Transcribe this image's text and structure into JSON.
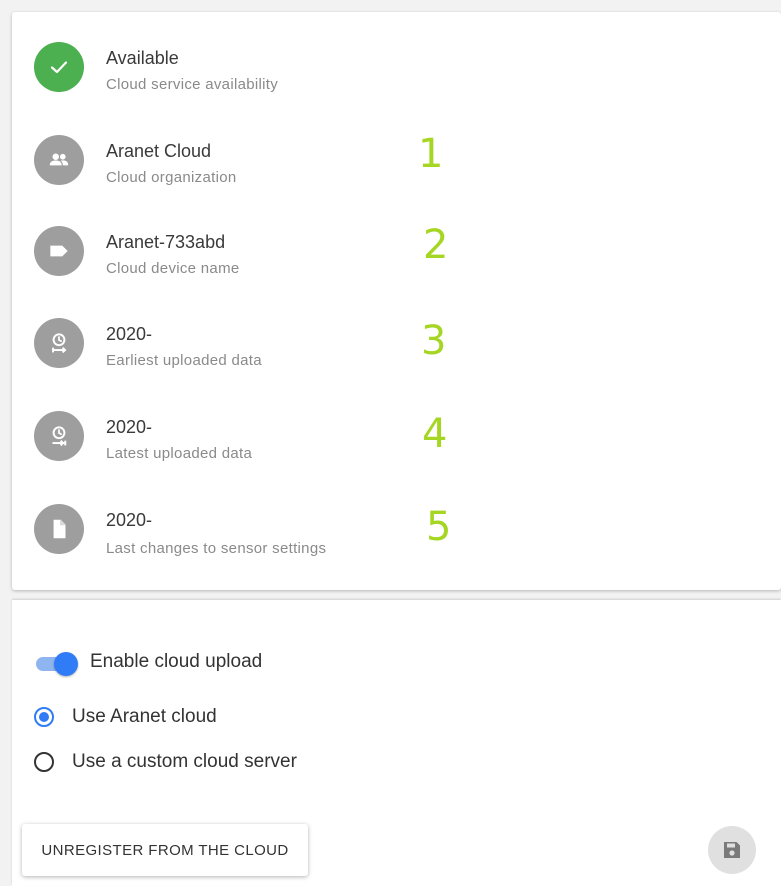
{
  "info_rows": [
    {
      "title": "Available",
      "subtitle": "Cloud service availability",
      "icon": "check-icon",
      "marker": ""
    },
    {
      "title": "Aranet Cloud",
      "subtitle": "Cloud organization",
      "icon": "people-icon",
      "marker": "1"
    },
    {
      "title": "Aranet-733abd",
      "subtitle": "Cloud device name",
      "icon": "label-icon",
      "marker": "2"
    },
    {
      "title": "2020-",
      "subtitle": "Earliest uploaded data",
      "icon": "clock-start-icon",
      "marker": "3"
    },
    {
      "title": "2020-",
      "subtitle": "Latest uploaded data",
      "icon": "clock-end-icon",
      "marker": "4"
    },
    {
      "title": "2020-",
      "subtitle": "Last changes to sensor settings",
      "icon": "file-icon",
      "marker": "5"
    }
  ],
  "settings": {
    "enable_upload_label": "Enable cloud upload",
    "enable_upload_on": true,
    "options": [
      {
        "label": "Use Aranet cloud",
        "selected": true
      },
      {
        "label": "Use a custom cloud server",
        "selected": false
      }
    ],
    "unregister_label": "UNREGISTER FROM THE CLOUD",
    "save_icon": "save-icon"
  },
  "colors": {
    "status_ok": "#4caf50",
    "icon_bg": "#9e9e9e",
    "accent": "#2f7cf6",
    "annotation": "#a6d624"
  }
}
